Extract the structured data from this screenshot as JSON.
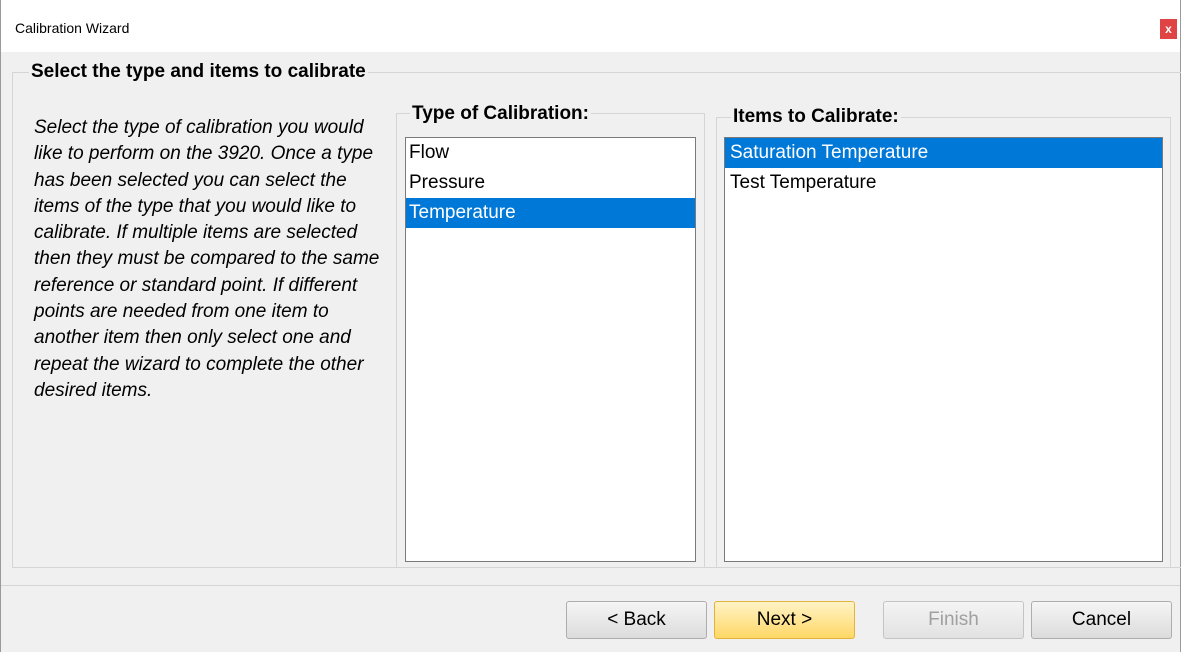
{
  "window": {
    "title": "Calibration Wizard",
    "close_label": "x"
  },
  "page": {
    "heading": "Select the type and items to calibrate",
    "description": "Select the type of calibration you would like to perform on the 3920.  Once a type has been selected you can select the items of the type that you would like to calibrate.   If multiple items are selected then they must be compared to the same reference or standard point.  If different points are needed from one item to another item then only select one and repeat the wizard to complete the other desired items."
  },
  "type_of_calibration": {
    "label": "Type of Calibration:",
    "items": [
      "Flow",
      "Pressure",
      "Temperature"
    ],
    "selected": "Temperature"
  },
  "items_to_calibrate": {
    "label": "Items to Calibrate:",
    "items": [
      "Saturation Temperature",
      "Test Temperature"
    ],
    "selected": [
      "Saturation Temperature"
    ]
  },
  "buttons": {
    "back": "< Back",
    "next": "Next >",
    "finish": "Finish",
    "cancel": "Cancel"
  },
  "colors": {
    "selection": "#0078d7",
    "close_button": "#e04343",
    "primary_button": "#ffd765"
  }
}
